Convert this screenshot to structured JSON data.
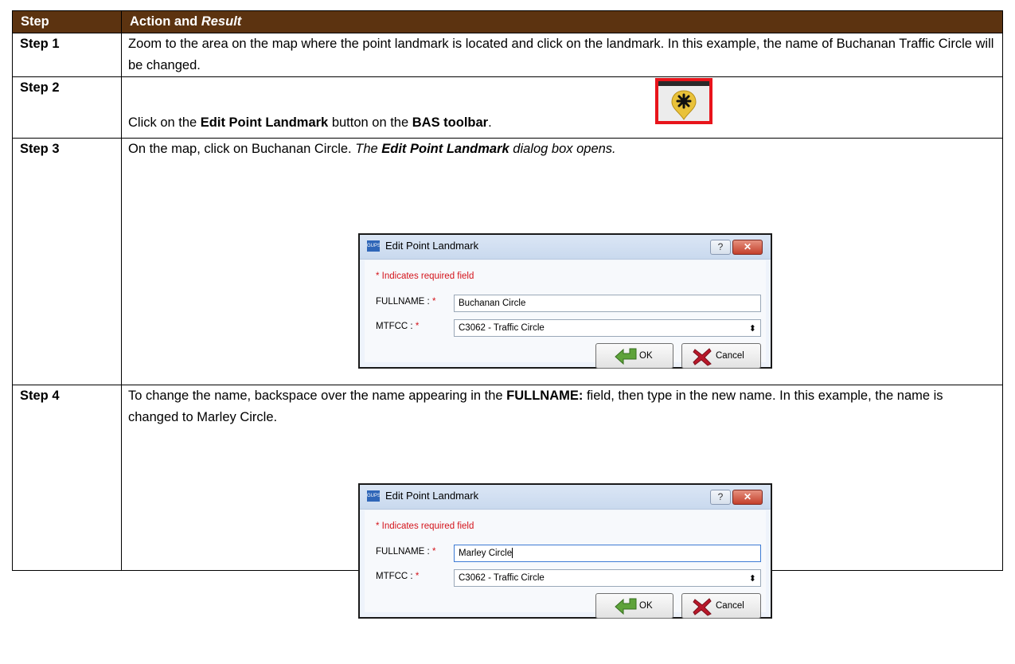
{
  "table": {
    "header": {
      "step": "Step",
      "action": "Action and ",
      "result": "Result"
    },
    "rows": [
      {
        "step": "Step 1",
        "text": "Zoom to the area on the map where the point landmark is located and click on the landmark. In this example, the name of Buchanan Traffic Circle will be changed."
      },
      {
        "step": "Step 2",
        "t1": "Click on the ",
        "b1": "Edit Point Landmark",
        "t2": " button on the ",
        "b2": "BAS toolbar",
        "t3": "."
      },
      {
        "step": "Step 3",
        "t1": "On the map, click on Buchanan Circle. ",
        "i1": "The ",
        "bi1": "Edit Point Landmark",
        "i2": " dialog box opens."
      },
      {
        "step": "Step 4",
        "t1": "To change the name, backspace over the name appearing in the ",
        "b1": "FULLNAME:",
        "t2": " field, then type in the new name. In this example, the name is changed to Marley Circle."
      }
    ]
  },
  "dialog1": {
    "icon_text": "GUPS",
    "title": "Edit Point Landmark",
    "help": "?",
    "close": "✕",
    "required_note": "* Indicates required field",
    "fullname_label": "FULLNAME : ",
    "fullname_value": "Buchanan Circle",
    "mtfcc_label": "MTFCC : ",
    "mtfcc_value": "C3062 - Traffic Circle",
    "star": "*",
    "ok": "OK",
    "cancel": "Cancel"
  },
  "dialog2": {
    "icon_text": "GUPS",
    "title": "Edit Point Landmark",
    "help": "?",
    "close": "✕",
    "required_note": "* Indicates required field",
    "fullname_label": "FULLNAME : ",
    "fullname_value": "Marley Circle",
    "mtfcc_label": "MTFCC : ",
    "mtfcc_value": "C3062 - Traffic Circle",
    "star": "*",
    "ok": "OK",
    "cancel": "Cancel"
  },
  "icons": {
    "toolbar_button": "edit-point-landmark-icon",
    "ok": "green-arrow-icon",
    "cancel": "red-x-icon",
    "select": "up-down-arrows-icon"
  },
  "colors": {
    "header_bg": "#5c3310",
    "highlight": "#e8141b",
    "required": "#d4141b"
  }
}
